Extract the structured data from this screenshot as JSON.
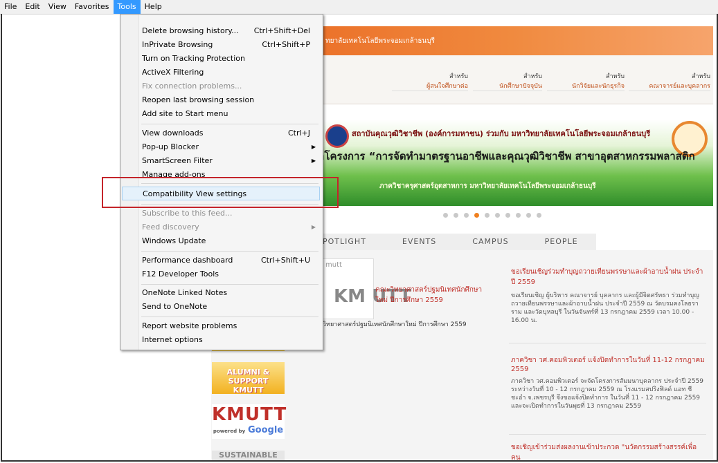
{
  "menubar": {
    "items": [
      "File",
      "Edit",
      "View",
      "Favorites",
      "Tools",
      "Help"
    ],
    "active": "Tools"
  },
  "page": {
    "header_title": "ทยาลัยเทคโนโลยีพระจอมเกล้าธนบุรี",
    "audiences": [
      {
        "line1": "สำหรับ",
        "line2": "ผู้สนใจศึกษาต่อ"
      },
      {
        "line1": "สำหรับ",
        "line2": "นักศึกษาปัจจุบัน"
      },
      {
        "line1": "สำหรับ",
        "line2": "นักวิจัยและนักธุรกิจ"
      },
      {
        "line1": "สำหรับ",
        "line2": "คณาจารย์และบุคลากร"
      }
    ],
    "slide": {
      "line1": "สถาบันคุณวุฒิวิชาชีพ (องค์การมหาชน) ร่วมกับ มหาวิทยาลัยเทคโนโลยีพระจอมเกล้าธนบุรี",
      "line2": "ำโครงการ “การจัดทำมาตรฐานอาชีพและคุณวุฒิวิชาชีพ สาขาอุตสาหกรรมพลาสติก",
      "line3": "ภาควิชาครุศาสตร์อุตสาหการ มหาวิทยาลัยเทคโนโลยีพระจอมเกล้าธนบุรี"
    },
    "tabs": [
      "POTLIGHT",
      "EVENTS",
      "CAMPUS",
      "PEOPLE"
    ],
    "thumb_label": "mutt",
    "thumb_logo": "KM UTT",
    "news_left": {
      "title": "คณะวิทยาศาสตร์ปฐมนิเทศนักศึกษาใหม่ ปีการศึกษา 2559",
      "caption": "วิทยาศาสตร์ปฐมนิเทศนักศึกษาใหม่ ปีการศึกษา 2559"
    },
    "news_right": [
      {
        "title": "ขอเรียนเชิญร่วมทำบุญถวายเทียนพรรษาและผ้าอาบน้ำฝน ประจำปี 2559",
        "body": "ขอเรียนเชิญ ผู้บริหาร คณาจารย์ บุคลากร และผู้มีจิตศรัทธา ร่วมทำบุญถวายเทียนพรรษาและผ้าอาบน้ำฝน ประจำปี 2559 ณ วัดบรมคงโลธราราม และวัดบุหลบุรี ในวันจันทร์ที่ 13 กรกฎาคม 2559 เวลา 10.00 - 16.00 น."
      },
      {
        "title": "ภาควิชา วศ.คอมพิวเตอร์ แจ้งปิดทำการในวันที่ 11-12 กรกฎาคม 2559",
        "body": "ภาควิชา วศ.คอมพิวเตอร์ จะจัดโครงการสัมมนาบุคลากร ประจำปี 2559 ระหว่างวันที่ 10 - 12 กรกฎาคม 2559 ณ โรงแรมสปริงฟิลด์ แอท ชี ชะอำ จ.เพชรบุรี จึงขอแจ้งปิดทำการ ในวันที่ 11 - 12 กรกฎาคม 2559 และจะเปิดทำการในวันพุธที่ 13 กรกฎาคม 2559"
      },
      {
        "title": "ขอเชิญเข้าร่วมส่งผลงานเข้าประกวด \"นวัตกรรมสร้างสรรค์เพื่อคน",
        "body": ""
      }
    ],
    "banners": {
      "alumni": "ALUMNI & SUPPORT KMUTT",
      "kmutt": "KMUTT",
      "google": "Google",
      "powered": "powered by",
      "sustainable": "SUSTAINABLE"
    }
  },
  "tools_menu": {
    "items": [
      {
        "label": "Delete browsing history...",
        "shortcut": "Ctrl+Shift+Del",
        "disabled": false
      },
      {
        "label": "InPrivate Browsing",
        "shortcut": "Ctrl+Shift+P",
        "disabled": false
      },
      {
        "label": "Turn on Tracking Protection",
        "shortcut": "",
        "disabled": false
      },
      {
        "label": "ActiveX Filtering",
        "shortcut": "",
        "disabled": false
      },
      {
        "label": "Fix connection problems...",
        "shortcut": "",
        "disabled": true
      },
      {
        "label": "Reopen last browsing session",
        "shortcut": "",
        "disabled": false
      },
      {
        "label": "Add site to Start menu",
        "shortcut": "",
        "disabled": false
      },
      {
        "label": "View downloads",
        "shortcut": "Ctrl+J",
        "disabled": false
      },
      {
        "label": "Pop-up Blocker",
        "shortcut": "",
        "submenu": true,
        "disabled": false
      },
      {
        "label": "SmartScreen Filter",
        "shortcut": "",
        "submenu": true,
        "disabled": false
      },
      {
        "label": "Manage add-ons",
        "shortcut": "",
        "disabled": false
      },
      {
        "label": "Compatibility View settings",
        "shortcut": "",
        "disabled": false,
        "highlighted": true
      },
      {
        "label": "Subscribe to this feed...",
        "shortcut": "",
        "disabled": true
      },
      {
        "label": "Feed discovery",
        "shortcut": "",
        "submenu": true,
        "disabled": true
      },
      {
        "label": "Windows Update",
        "shortcut": "",
        "disabled": false
      },
      {
        "label": "Performance dashboard",
        "shortcut": "Ctrl+Shift+U",
        "disabled": false
      },
      {
        "label": "F12 Developer Tools",
        "shortcut": "",
        "disabled": false
      },
      {
        "label": "OneNote Linked Notes",
        "shortcut": "",
        "disabled": false
      },
      {
        "label": "Send to OneNote",
        "shortcut": "",
        "disabled": false
      },
      {
        "label": "Report website problems",
        "shortcut": "",
        "disabled": false
      },
      {
        "label": "Internet options",
        "shortcut": "",
        "disabled": false
      }
    ]
  },
  "colors": {
    "menu_highlight": "#e5f1fb",
    "menubar_active": "#3399ff",
    "annotation_box": "#c4242a",
    "header_orange": "#e9651e"
  }
}
